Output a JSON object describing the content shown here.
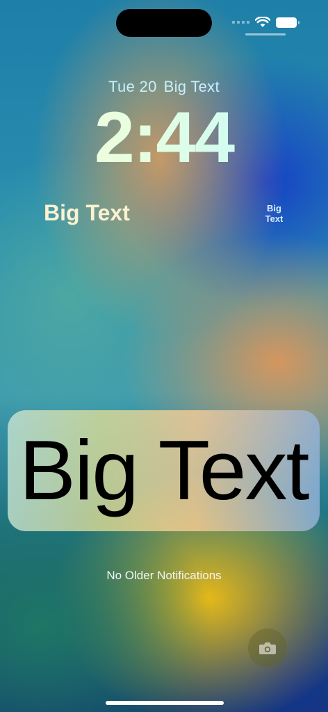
{
  "lock_screen": {
    "date": "Tue 20",
    "date_widget": "Big Text",
    "time": "2:44",
    "widget_left": "Big Text",
    "widget_right": "Big Text"
  },
  "notification": {
    "text": "Big Text"
  },
  "older_notifications": "No Older Notifications",
  "icons": {
    "wifi": "wifi-icon",
    "battery": "battery-icon",
    "cellular": "cellular-signal-icon",
    "camera": "camera-icon"
  },
  "colors": {
    "date_text": "#c9f0ff",
    "notification_text": "#000000"
  }
}
